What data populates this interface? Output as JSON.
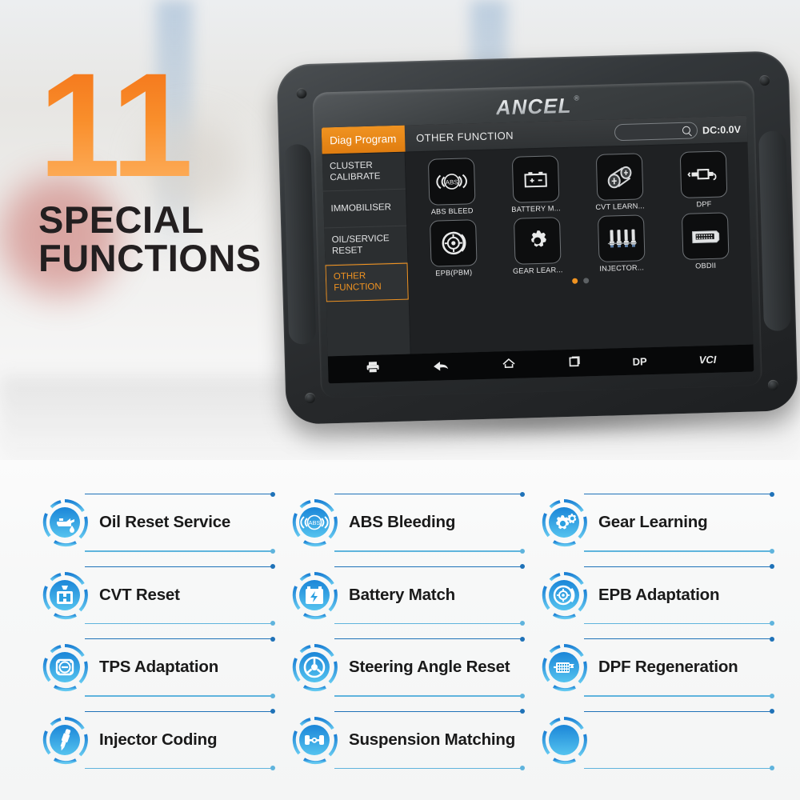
{
  "headline": {
    "number": "11",
    "line1": "SPECIAL",
    "line2": "FUNCTIONS",
    "accent_color": "#f4761b"
  },
  "device": {
    "brand": "ANCEL",
    "registered_mark": "®",
    "screen": {
      "topbar": {
        "tab_label": "Diag Program",
        "title": "OTHER FUNCTION",
        "search_placeholder": "",
        "search_value": "",
        "voltage": "DC:0.0V"
      },
      "sidebar": [
        {
          "label": "CLUSTER CALIBRATE",
          "active": false
        },
        {
          "label": "IMMOBILISER",
          "active": false
        },
        {
          "label": "OIL/SERVICE RESET",
          "active": false
        },
        {
          "label": "OTHER FUNCTION",
          "active": true
        }
      ],
      "functions": [
        {
          "label": "ABS BLEED",
          "icon": "abs-icon"
        },
        {
          "label": "BATTERY M...",
          "icon": "battery-icon"
        },
        {
          "label": "CVT LEARN...",
          "icon": "cvt-belt-icon"
        },
        {
          "label": "DPF",
          "icon": "dpf-filter-icon"
        },
        {
          "label": "EPB(PBM)",
          "icon": "brake-disc-icon"
        },
        {
          "label": "GEAR LEAR...",
          "icon": "gear-icon"
        },
        {
          "label": "INJECTOR...",
          "icon": "injector-icon"
        },
        {
          "label": "OBDII",
          "icon": "obd-connector-icon"
        }
      ],
      "pagination": {
        "total": 2,
        "active": 1
      },
      "navbar": [
        {
          "label": "",
          "icon": "print-icon"
        },
        {
          "label": "",
          "icon": "back-arrow-icon"
        },
        {
          "label": "",
          "icon": "home-icon"
        },
        {
          "label": "",
          "icon": "recent-apps-icon"
        },
        {
          "label": "DP",
          "icon": ""
        },
        {
          "label": "VCI",
          "icon": ""
        }
      ]
    }
  },
  "feature_list": {
    "accent_top": "#1f72b8",
    "accent_bottom": "#5fb4dd",
    "items": [
      {
        "label": "Oil Reset Service",
        "icon": "oil-can-icon"
      },
      {
        "label": "ABS Bleeding",
        "icon": "abs-icon"
      },
      {
        "label": "Gear Learning",
        "icon": "gears-icon"
      },
      {
        "label": "CVT Reset",
        "icon": "cvt-icon"
      },
      {
        "label": "Battery Match",
        "icon": "battery-icon"
      },
      {
        "label": "EPB Adaptation",
        "icon": "brake-disc-icon"
      },
      {
        "label": "TPS Adaptation",
        "icon": "throttle-body-icon"
      },
      {
        "label": "Steering Angle Reset",
        "icon": "steering-wheel-icon"
      },
      {
        "label": "DPF Regeneration",
        "icon": "dpf-filter-icon"
      },
      {
        "label": "Injector Coding",
        "icon": "injector-icon"
      },
      {
        "label": "Suspension Matching",
        "icon": "suspension-axle-icon"
      },
      {
        "label": "",
        "icon": ""
      }
    ]
  }
}
